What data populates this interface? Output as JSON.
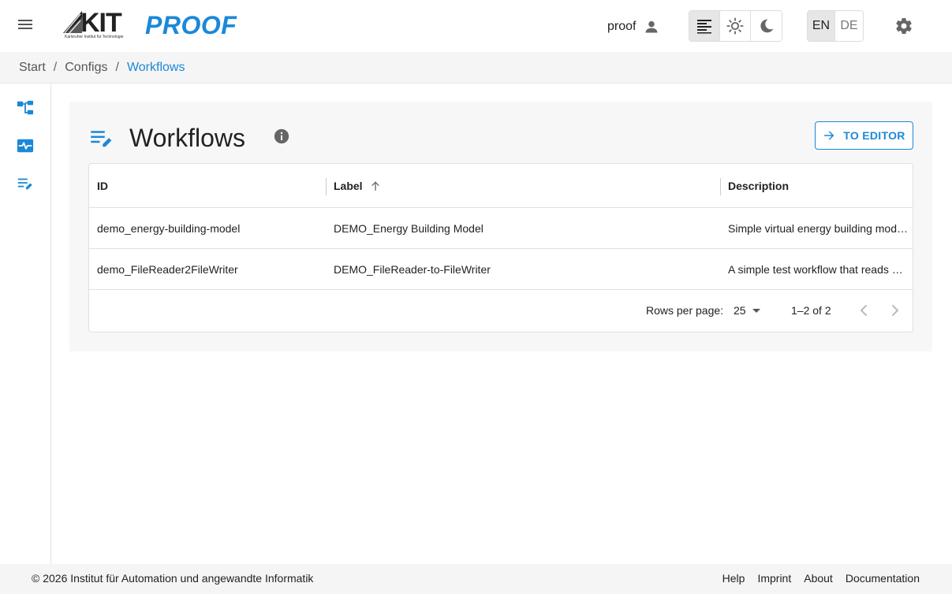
{
  "header": {
    "kit_logo_text": "KIT",
    "kit_logo_sub": "Karlsruher Institut für Technologie",
    "app_title": "PROOF",
    "username": "proof",
    "languages": [
      "EN",
      "DE"
    ],
    "active_language": "EN"
  },
  "breadcrumb": {
    "items": [
      "Start",
      "Configs",
      "Workflows"
    ],
    "separator": "/"
  },
  "page": {
    "title": "Workflows",
    "to_editor_label": "TO EDITOR"
  },
  "table": {
    "columns": [
      "ID",
      "Label",
      "Description"
    ],
    "sorted_column": "Label",
    "sort_direction": "ascending",
    "rows": [
      {
        "id": "demo_energy-building-model",
        "label": "DEMO_Energy Building Model",
        "description": "Simple virtual energy building mod…"
      },
      {
        "id": "demo_FileReader2FileWriter",
        "label": "DEMO_FileReader-to-FileWriter",
        "description": "A simple test workflow that reads …"
      }
    ],
    "rows_per_page_label": "Rows per page:",
    "rows_per_page": "25",
    "page_range": "1–2 of 2"
  },
  "footer": {
    "copyright": "© 2026 Institut für Automation und angewandte Informatik",
    "links": [
      "Help",
      "Imprint",
      "About",
      "Documentation"
    ]
  },
  "colors": {
    "accent": "#1b88d8",
    "sidebar_icon": "#1b88d8"
  }
}
